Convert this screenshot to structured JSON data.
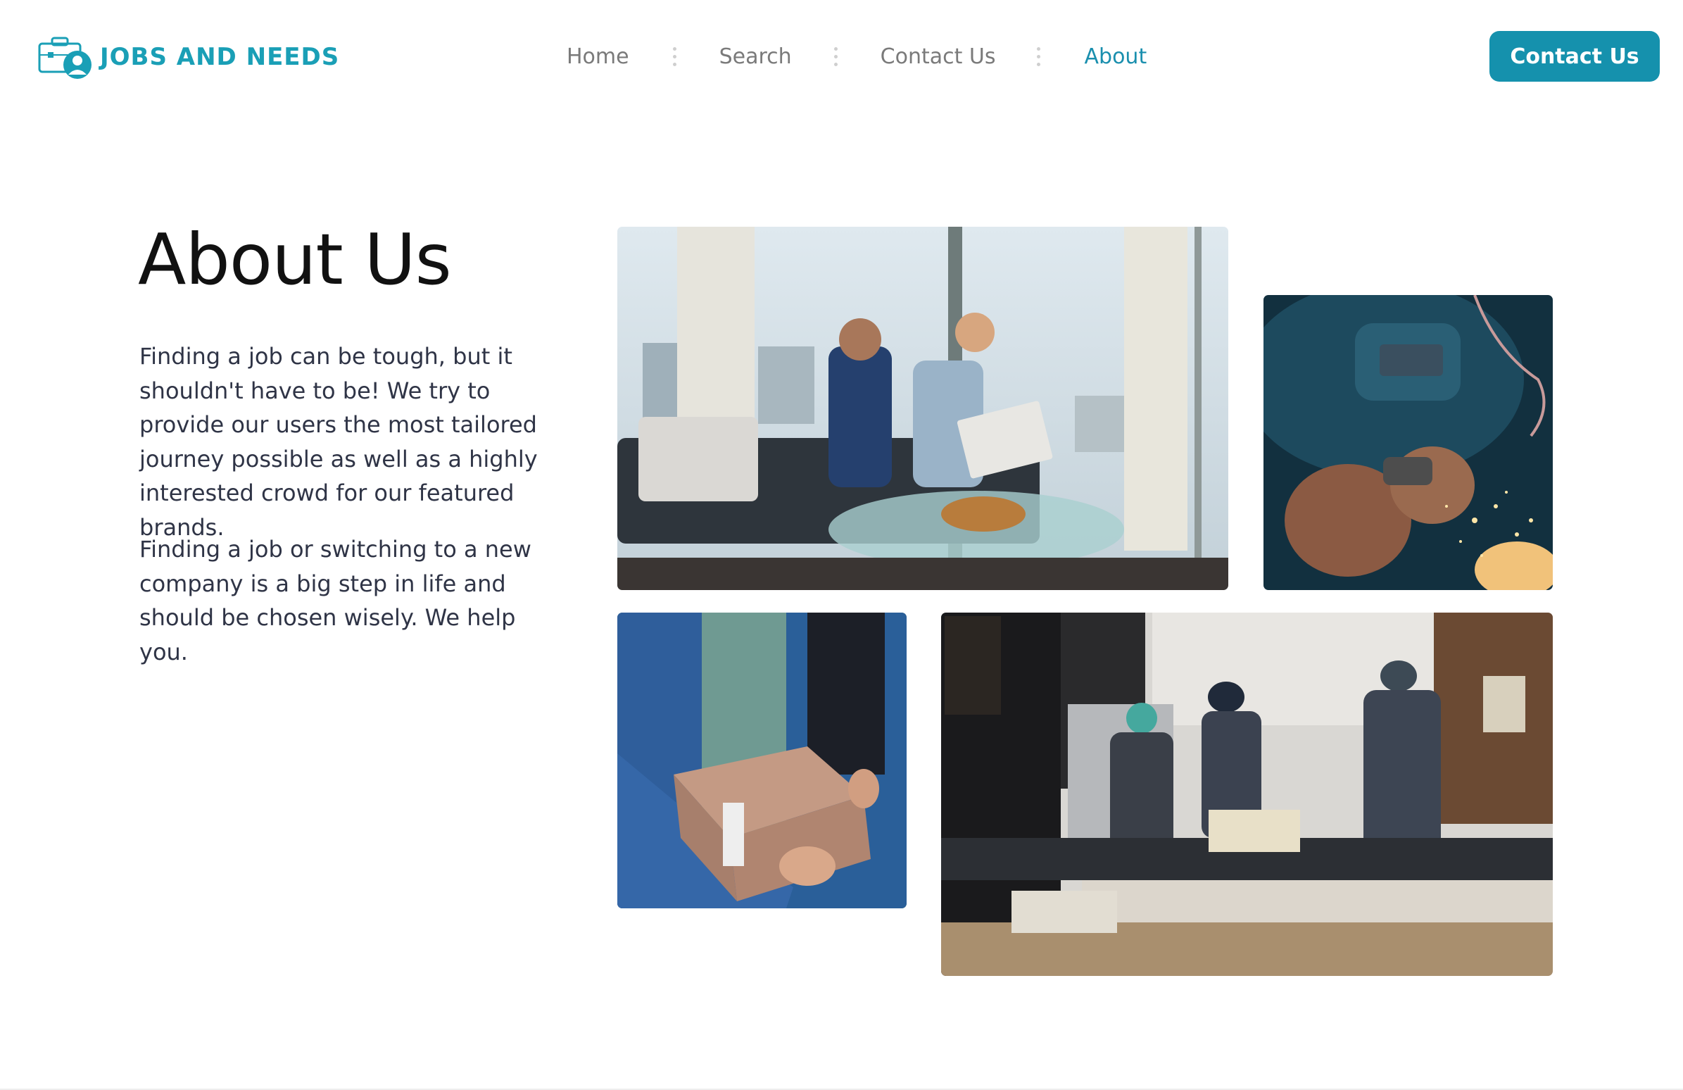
{
  "brand": {
    "name": "JOBS AND NEEDS",
    "color": "#1a9fb6"
  },
  "nav": {
    "items": [
      {
        "label": "Home",
        "active": false
      },
      {
        "label": "Search",
        "active": false
      },
      {
        "label": "Contact Us",
        "active": false
      },
      {
        "label": "About",
        "active": true
      }
    ]
  },
  "header": {
    "cta_label": "Contact Us",
    "cta_color": "#1591ad"
  },
  "about": {
    "title": "About Us",
    "paragraphs": [
      "Finding a job can be tough, but it shouldn't have to be! We try to provide our users the most tailored journey possible as well as a highly interested crowd for our featured brands.",
      "Finding a job or switching to a new company is a big step in life and should be chosen wisely. We help you."
    ]
  },
  "gallery": {
    "images": [
      {
        "subject": "office-meeting-photo"
      },
      {
        "subject": "welder-photo"
      },
      {
        "subject": "package-delivery-photo"
      },
      {
        "subject": "restaurant-kitchen-photo"
      }
    ]
  }
}
